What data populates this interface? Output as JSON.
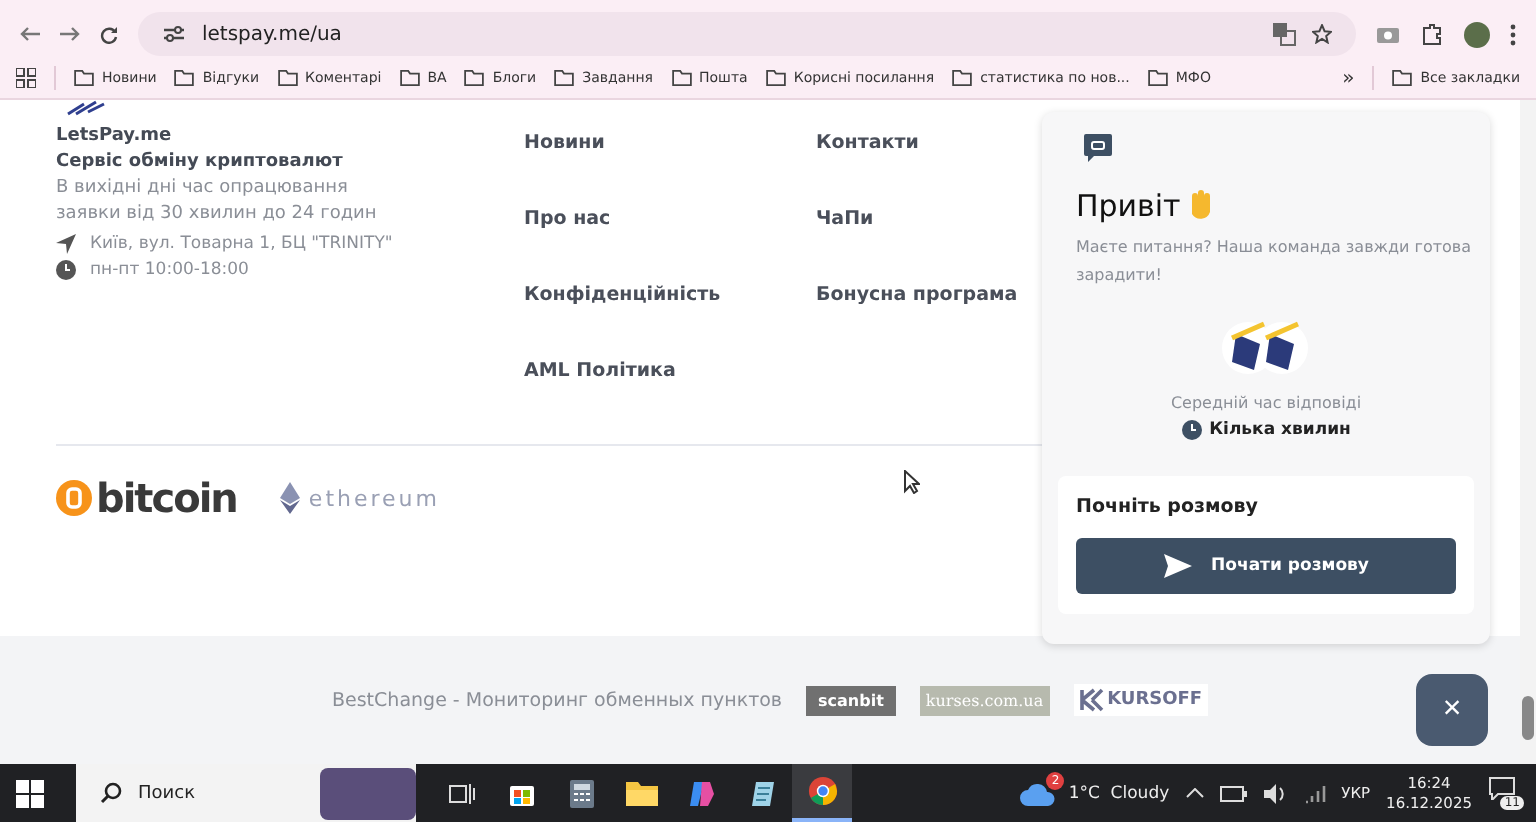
{
  "browser": {
    "url": "letspay.me/ua",
    "bookmarks": [
      "Новини",
      "Відгуки",
      "Коментарі",
      "ВА",
      "Блоги",
      "Завдання",
      "Пошта",
      "Корисні посилання",
      "статистика по нов...",
      "МФО"
    ],
    "more": "»",
    "all_bookmarks": "Все закладки"
  },
  "footer": {
    "brand": "LetsPay.me",
    "tagline": "Сервіс обміну криптовалют",
    "note": "В вихідні дні час опрацювання заявки від 30 хвилин до 24 годин",
    "address": "Київ, вул. Товарна 1, БЦ \"TRINITY\"",
    "hours": "пн-пт 10:00-18:00",
    "links": [
      [
        "Новини",
        "Про нас",
        "Конфіденційність",
        "AML Політика"
      ],
      [
        "Контакти",
        "ЧаПи",
        "Бонусна програма"
      ]
    ],
    "coins": [
      "bitcoin",
      "ethereum"
    ],
    "partners": [
      {
        "kind": "broken",
        "text": "BestChange - Мониторинг обменных пунктов"
      },
      {
        "kind": "scanbit",
        "text": "scanbit"
      },
      {
        "kind": "kurses",
        "text": "kurses.com.ua"
      },
      {
        "kind": "kursoff",
        "text": "KURSOFF"
      }
    ]
  },
  "chat": {
    "title": "Привіт",
    "subtitle": "Маєте питання? Наша команда завжди готова зарадити!",
    "reply_label": "Середній час відповіді",
    "reply_time": "Кілька хвилин",
    "start_title": "Почніть розмову",
    "start_button": "Почати розмову",
    "close": "×"
  },
  "taskbar": {
    "search": "Поиск",
    "weather_badge": "2",
    "weather": "1°C  Cloudy",
    "language": "УКР",
    "time": "16:24",
    "date": "16.12.2025",
    "notifications": "11"
  }
}
